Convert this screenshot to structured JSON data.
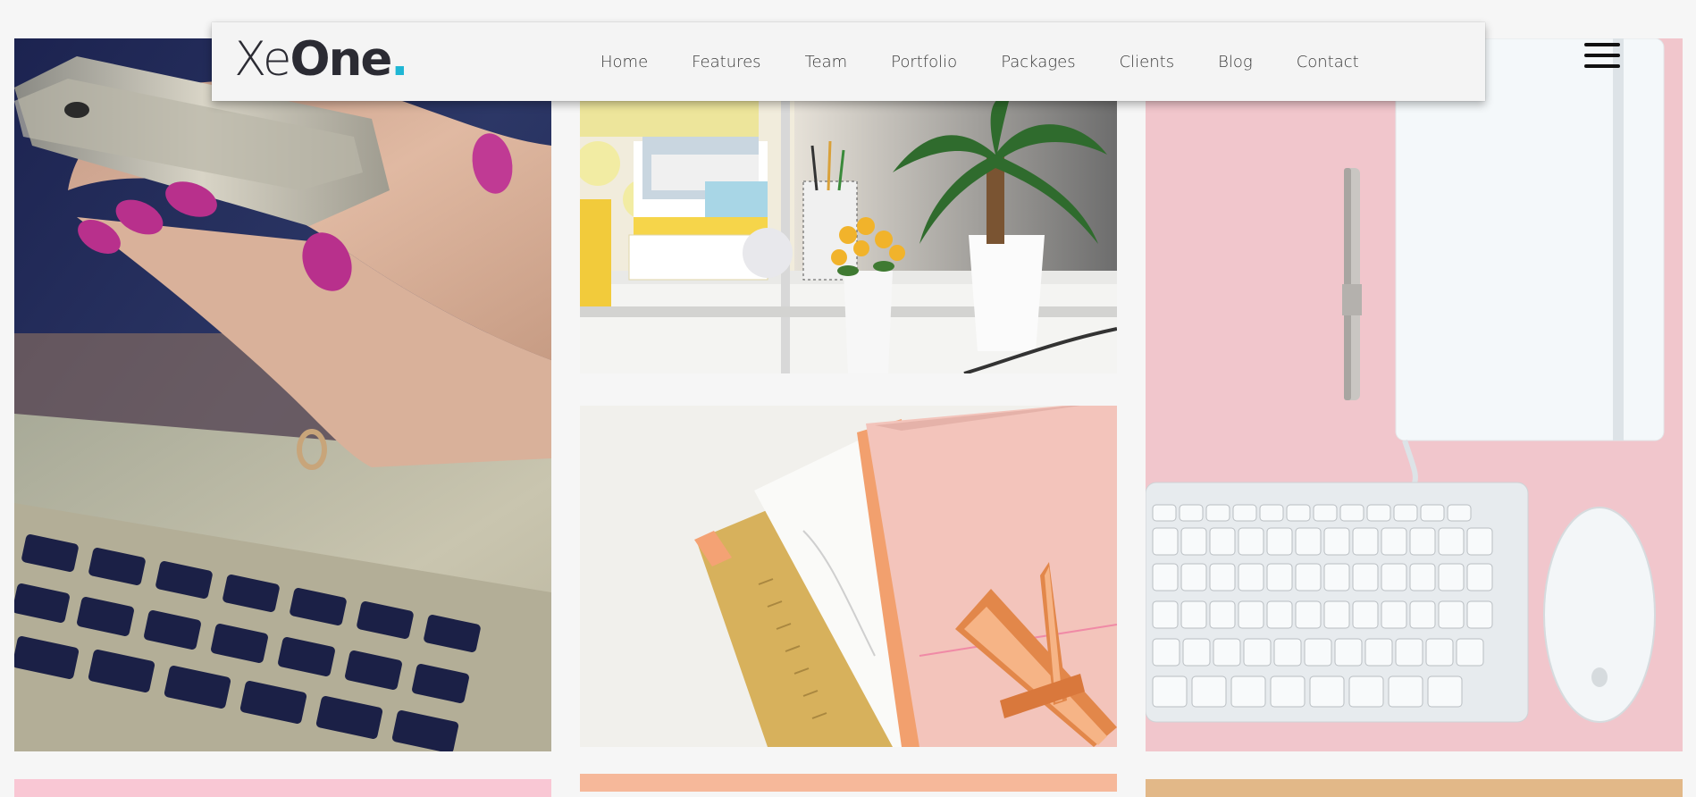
{
  "header": {
    "logo": {
      "part1": "Xe",
      "part2": "One",
      "dot": "."
    },
    "nav": [
      {
        "label": "Home"
      },
      {
        "label": "Features"
      },
      {
        "label": "Team"
      },
      {
        "label": "Portfolio"
      },
      {
        "label": "Packages"
      },
      {
        "label": "Clients"
      },
      {
        "label": "Blog"
      },
      {
        "label": "Contact"
      }
    ],
    "menu_icon": "hamburger-icon"
  },
  "gallery": {
    "images": [
      {
        "name": "photo-phone-laptop"
      },
      {
        "name": "photo-desk-plants"
      },
      {
        "name": "photo-notebooks-pens"
      },
      {
        "name": "photo-keyboard-mouse"
      },
      {
        "name": "photo-bottom-1"
      },
      {
        "name": "photo-bottom-2"
      },
      {
        "name": "photo-bottom-3"
      }
    ]
  },
  "colors": {
    "background": "#f6f6f6",
    "logo_accent": "#1fb6d4",
    "logo_text": "#2b2b33",
    "nav_text": "#3a3a3a"
  }
}
